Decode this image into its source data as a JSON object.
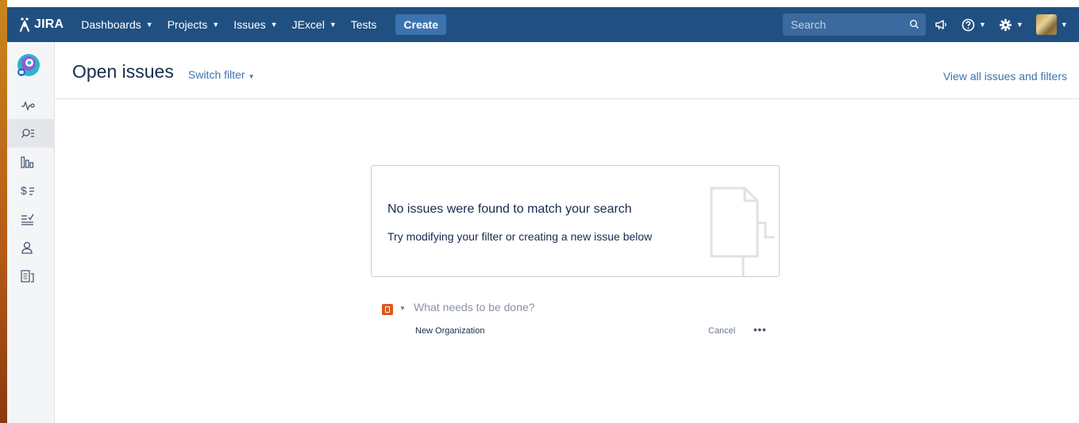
{
  "topnav": {
    "logo": "JIRA",
    "items": [
      {
        "label": "Dashboards",
        "has_caret": true
      },
      {
        "label": "Projects",
        "has_caret": true
      },
      {
        "label": "Issues",
        "has_caret": true
      },
      {
        "label": "JExcel",
        "has_caret": true
      },
      {
        "label": "Tests",
        "has_caret": false
      }
    ],
    "create_label": "Create",
    "search_placeholder": "Search",
    "icons": [
      "notifications-icon",
      "help-icon",
      "settings-icon",
      "user-avatar"
    ]
  },
  "sidebar": {
    "items": [
      {
        "icon": "activity-icon",
        "active": false
      },
      {
        "icon": "issues-search-icon",
        "active": true
      },
      {
        "icon": "reports-icon",
        "active": false
      },
      {
        "icon": "cost-icon",
        "active": false
      },
      {
        "icon": "checklist-icon",
        "active": false
      },
      {
        "icon": "user-icon",
        "active": false
      },
      {
        "icon": "pages-icon",
        "active": false
      }
    ]
  },
  "header": {
    "title": "Open issues",
    "switch_filter": "Switch filter",
    "view_all": "View all issues and filters"
  },
  "empty_state": {
    "title": "No issues were found to match your search",
    "subtitle": "Try modifying your filter or creating a new issue below"
  },
  "inline_create": {
    "placeholder": "What needs to be done?",
    "organization": "New Organization",
    "cancel": "Cancel",
    "more": "•••"
  },
  "colors": {
    "nav_bg": "#205081",
    "link": "#3b73af",
    "issue_type": "#e0571a"
  }
}
